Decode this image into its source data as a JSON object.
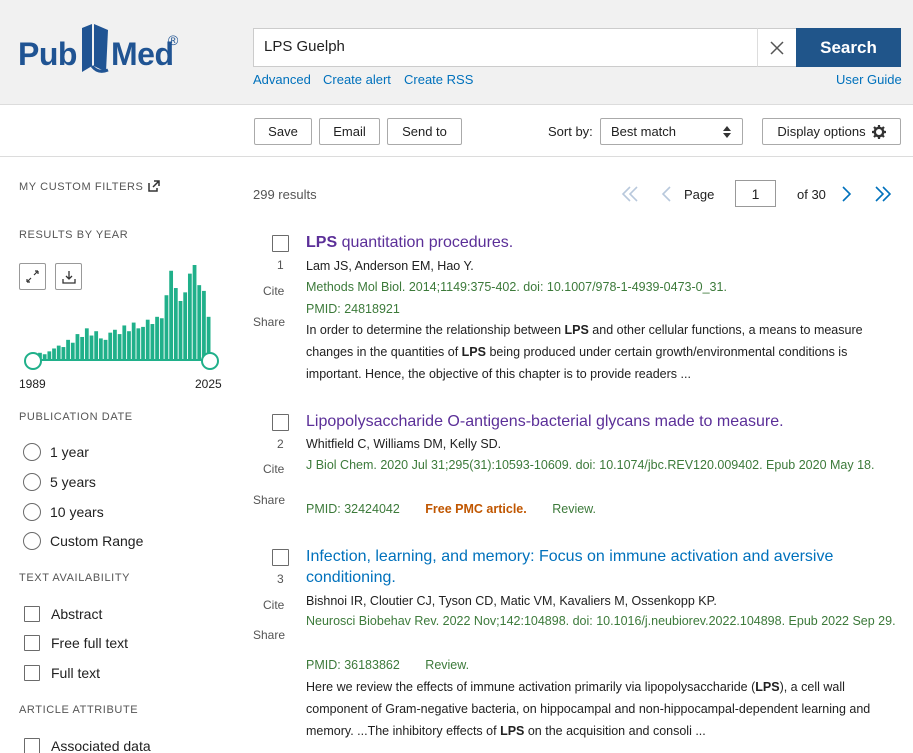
{
  "header": {
    "logo_pub": "Pub",
    "logo_med": "Med",
    "logo_reg": "®",
    "search_value": "LPS Guelph",
    "search_label": "Search",
    "links": {
      "advanced": "Advanced",
      "create_alert": "Create alert",
      "create_rss": "Create RSS",
      "user_guide": "User Guide"
    }
  },
  "toolbar": {
    "save": "Save",
    "email": "Email",
    "send_to": "Send to",
    "sort_label": "Sort by:",
    "sort_value": "Best match",
    "display_options": "Display options"
  },
  "sidebar": {
    "custom_filters": "MY CUSTOM FILTERS",
    "results_by_year": "RESULTS BY YEAR",
    "year_start": "1989",
    "year_end": "2025",
    "histogram": [
      3,
      5,
      4,
      6,
      8,
      10,
      9,
      14,
      12,
      18,
      16,
      22,
      17,
      20,
      15,
      14,
      19,
      21,
      18,
      24,
      20,
      26,
      22,
      23,
      28,
      25,
      30,
      29,
      45,
      62,
      50,
      41,
      47,
      60,
      66,
      52,
      48,
      30
    ],
    "publication_date": "PUBLICATION DATE",
    "date_options": [
      "1 year",
      "5 years",
      "10 years",
      "Custom Range"
    ],
    "text_availability": "TEXT AVAILABILITY",
    "text_options": [
      "Abstract",
      "Free full text",
      "Full text"
    ],
    "article_attribute": "ARTICLE ATTRIBUTE",
    "attr_options": [
      "Associated data"
    ]
  },
  "results": {
    "count": "299 results",
    "page_label": "Page",
    "page_value": "1",
    "page_of": "of 30",
    "cite": "Cite",
    "share": "Share",
    "items": [
      {
        "num": "1",
        "title_bold": "LPS",
        "title_rest": " quantitation procedures.",
        "authors": "Lam JS, Anderson EM, Hao Y.",
        "journal": "Methods Mol Biol. 2014;1149:375-402. doi: 10.1007/978-1-4939-0473-0_31.",
        "pmid": "PMID: 24818921",
        "snip_1": "In order to determine the relationship between ",
        "snip_b1": "LPS",
        "snip_2": " and other cellular functions, a means to measure changes in the quantities of ",
        "snip_b2": "LPS",
        "snip_3": " being produced under certain growth/environmental conditions is important. Hence, the objective of this chapter is to provide readers ..."
      },
      {
        "num": "2",
        "title": "Lipopolysaccharide O-antigens-bacterial glycans made to measure.",
        "authors": "Whitfield C, Williams DM, Kelly SD.",
        "journal": "J Biol Chem. 2020 Jul 31;295(31):10593-10609. doi: 10.1074/jbc.REV120.009402. Epub 2020 May 18.",
        "pmid": "PMID: 32424042",
        "free_pmc": "Free PMC article.",
        "review": "Review."
      },
      {
        "num": "3",
        "title": "Infection, learning, and memory: Focus on immune activation and aversive conditioning.",
        "authors": "Bishnoi IR, Cloutier CJ, Tyson CD, Matic VM, Kavaliers M, Ossenkopp KP.",
        "journal": "Neurosci Biobehav Rev. 2022 Nov;142:104898. doi: 10.1016/j.neubiorev.2022.104898. Epub 2022 Sep 29.",
        "pmid": "PMID: 36183862",
        "review": "Review.",
        "snip_1": "Here we review the effects of immune activation primarily via lipopolysaccharide (",
        "snip_b1": "LPS",
        "snip_2": "), a cell wall component of Gram-negative bacteria, on hippocampal and non-hippocampal-dependent learning and memory. ...The inhibitory effects of ",
        "snip_b2": "LPS",
        "snip_3": " on the acquisition and consoli ..."
      }
    ]
  },
  "colors": {
    "brand": "#205493",
    "link": "#0071bc",
    "visited": "#5b2f98",
    "journal": "#3c7a3a",
    "histogram": "#20b08a"
  }
}
